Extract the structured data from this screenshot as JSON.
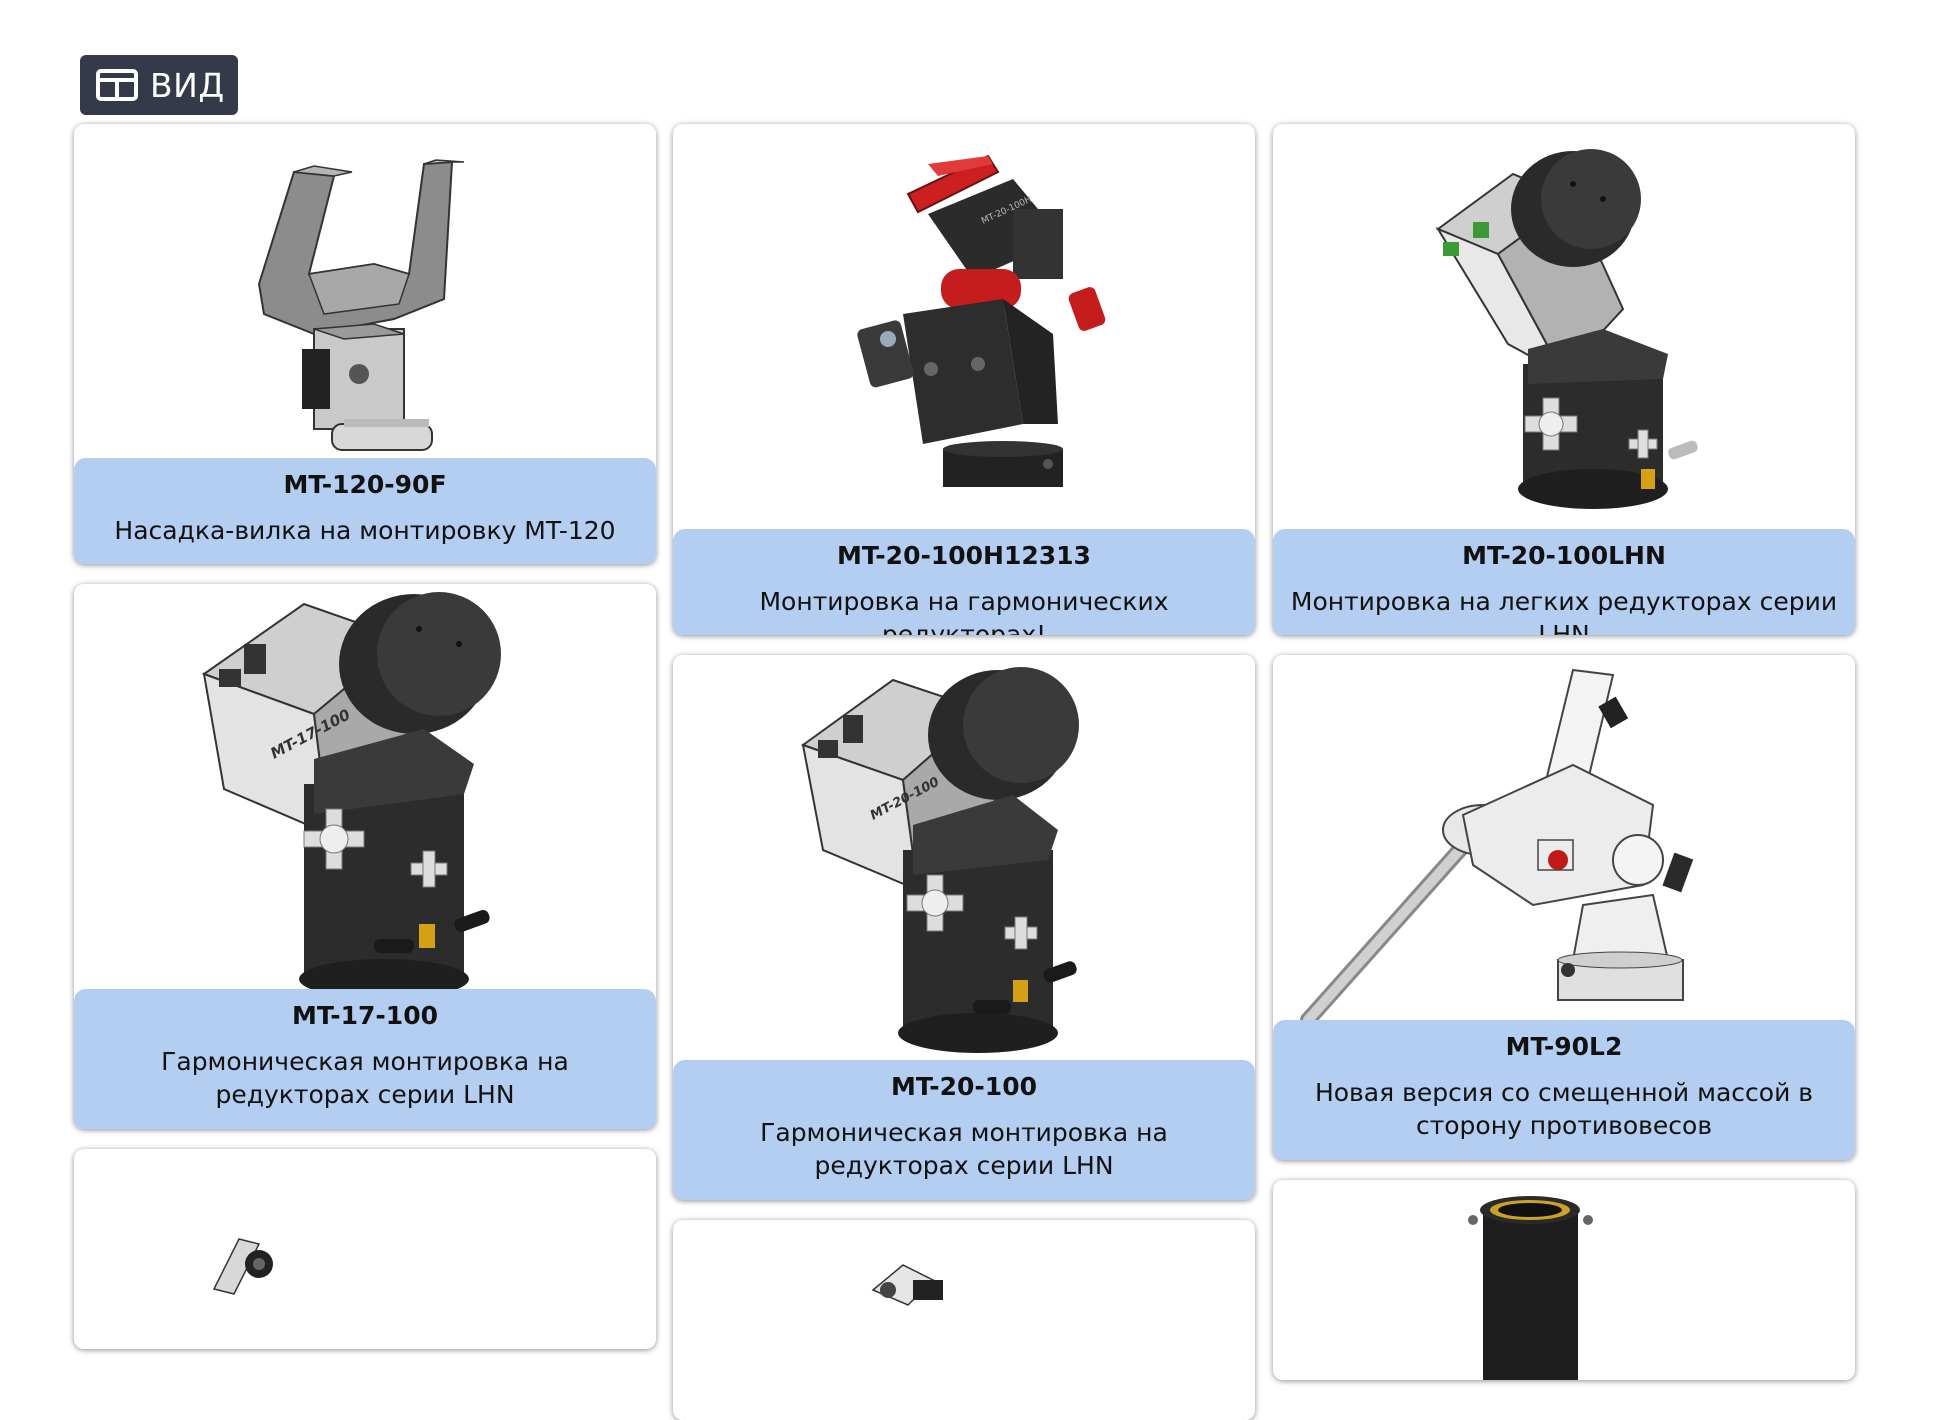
{
  "toolbar": {
    "view_label": "ВИД"
  },
  "products": [
    {
      "name": "MT-120-90F",
      "desc": "Насадка-вилка на монтировку MT-120"
    },
    {
      "name": "MT-20-100H12313",
      "desc": "Монтировка на гармонических редукторах!"
    },
    {
      "name": "MT-20-100LHN",
      "desc": "Монтировка на легких редукторах серии LHN"
    },
    {
      "name": "MT-17-100",
      "desc": "Гармоническая монтировка на редукторах серии LHN"
    },
    {
      "name": "MT-20-100",
      "desc": "Гармоническая монтировка на редукторах серии LHN"
    },
    {
      "name": "MT-90L2",
      "desc": "Новая версия со смещенной массой в сторону противовесов"
    }
  ],
  "product_images": {
    "mt-120-90f": {
      "label": "MT-120-90F",
      "body_label": ""
    },
    "mt-17-100": {
      "label": "MT-17-100"
    },
    "mt-20-100": {
      "label": "MT-20-100"
    },
    "mt-20-100h12313": {
      "label": "MT-20-100H"
    }
  }
}
